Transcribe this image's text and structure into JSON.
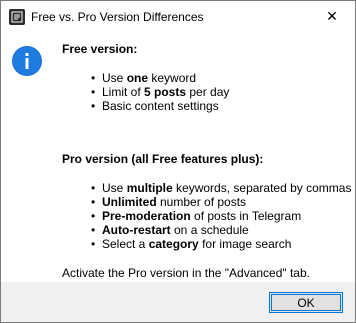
{
  "window": {
    "title": "Free vs. Pro Version Differences",
    "close_symbol": "✕",
    "app_icon": "app-icon",
    "info_icon": "info-icon",
    "accent_color": "#0078d7"
  },
  "free": {
    "heading": "Free version:",
    "items": [
      {
        "pre": "Use ",
        "bold": "one",
        "post": " keyword"
      },
      {
        "pre": "Limit of ",
        "bold": "5 posts",
        "post": " per day"
      },
      {
        "pre": "Basic content settings",
        "bold": "",
        "post": ""
      }
    ]
  },
  "pro": {
    "heading": "Pro version (all Free features plus):",
    "items": [
      {
        "pre": "Use ",
        "bold": "multiple",
        "post": " keywords, separated by commas"
      },
      {
        "pre": "",
        "bold": "Unlimited",
        "post": " number of posts"
      },
      {
        "pre": "",
        "bold": "Pre-moderation",
        "post": " of posts in Telegram"
      },
      {
        "pre": "",
        "bold": "Auto-restart",
        "post": " on a schedule"
      },
      {
        "pre": "Select a ",
        "bold": "category",
        "post": " for image search"
      }
    ]
  },
  "note": "Activate the Pro version in the \"Advanced\" tab.",
  "ok_label": "OK"
}
